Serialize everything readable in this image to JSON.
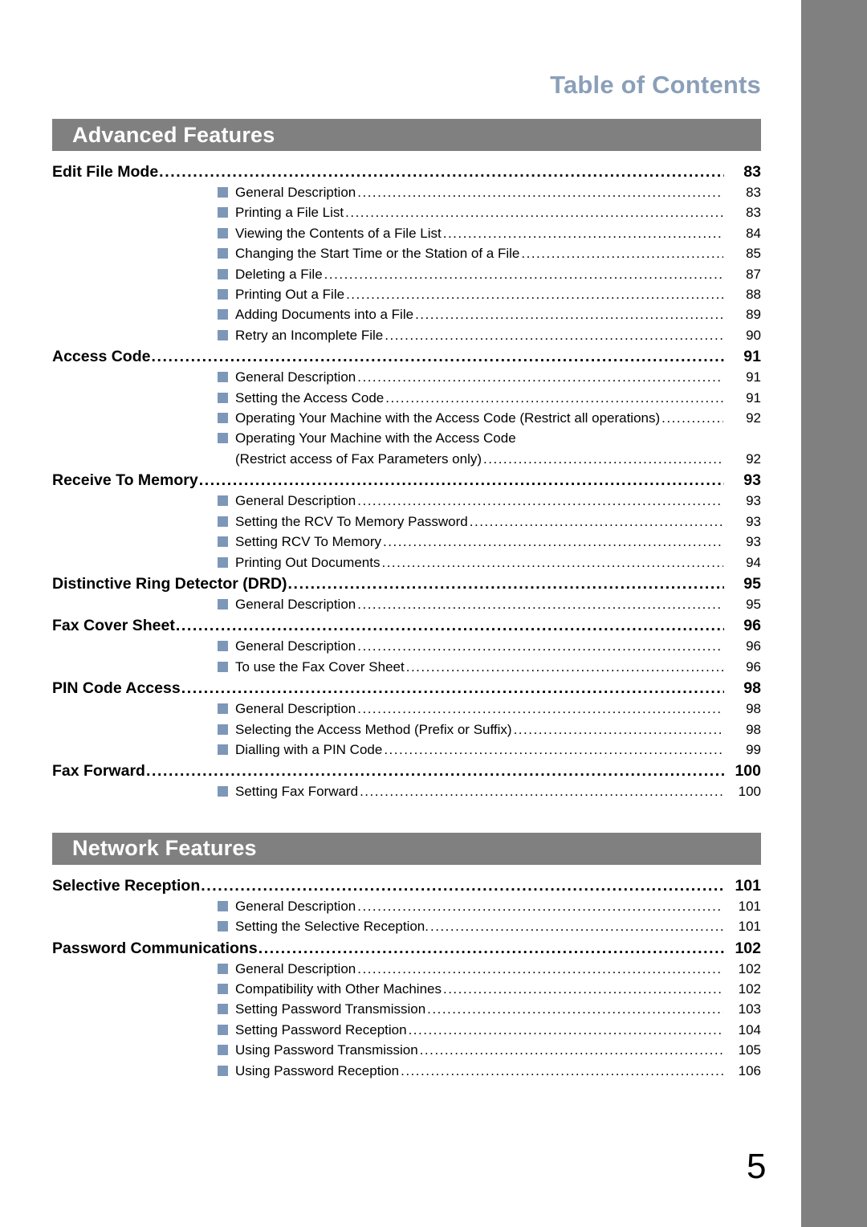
{
  "header": {
    "running_head": "Table of Contents"
  },
  "folio": "5",
  "leader_dots": "..................................................................................................................................................................",
  "sections": [
    {
      "band_label": "Advanced Features",
      "entries": [
        {
          "label": "Edit File Mode",
          "page": "83",
          "children": [
            {
              "label": "General Description",
              "page": "83"
            },
            {
              "label": "Printing a File List",
              "page": "83"
            },
            {
              "label": "Viewing the Contents of a File List",
              "page": "84"
            },
            {
              "label": "Changing the Start Time or the Station of a File",
              "page": "85"
            },
            {
              "label": "Deleting a File",
              "page": "87"
            },
            {
              "label": "Printing Out a File",
              "page": "88"
            },
            {
              "label": "Adding Documents into a File",
              "page": "89"
            },
            {
              "label": "Retry an Incomplete File",
              "page": "90"
            }
          ]
        },
        {
          "label": "Access Code",
          "page": "91",
          "children": [
            {
              "label": "General Description",
              "page": "91"
            },
            {
              "label": "Setting the Access Code",
              "page": "91"
            },
            {
              "label": "Operating Your Machine with the Access Code (Restrict all operations)",
              "page": "92"
            },
            {
              "label": "Operating Your Machine with the Access Code",
              "label_line2": "(Restrict access of Fax Parameters only)",
              "page": "92"
            }
          ]
        },
        {
          "label": "Receive To Memory",
          "page": "93",
          "children": [
            {
              "label": "General Description",
              "page": "93"
            },
            {
              "label": "Setting the RCV To Memory Password",
              "page": "93"
            },
            {
              "label": "Setting RCV To Memory",
              "page": "93"
            },
            {
              "label": "Printing Out Documents",
              "page": "94"
            }
          ]
        },
        {
          "label": "Distinctive Ring Detector (DRD)",
          "page": "95",
          "children": [
            {
              "label": "General Description",
              "page": "95"
            }
          ]
        },
        {
          "label": "Fax Cover Sheet",
          "page": "96",
          "children": [
            {
              "label": "General Description",
              "page": "96"
            },
            {
              "label": "To use the Fax Cover Sheet",
              "page": "96"
            }
          ]
        },
        {
          "label": "PIN Code Access",
          "page": "98",
          "children": [
            {
              "label": "General Description",
              "page": "98"
            },
            {
              "label": "Selecting the Access Method (Prefix or Suffix)",
              "page": "98"
            },
            {
              "label": "Dialling with a PIN Code",
              "page": "99"
            }
          ]
        },
        {
          "label": "Fax Forward",
          "page": "100",
          "children": [
            {
              "label": "Setting Fax Forward",
              "page": "100"
            }
          ]
        }
      ]
    },
    {
      "band_label": "Network Features",
      "entries": [
        {
          "label": "Selective Reception",
          "page": "101",
          "children": [
            {
              "label": "General Description",
              "page": "101"
            },
            {
              "label": "Setting the Selective Reception.",
              "page": "101"
            }
          ]
        },
        {
          "label": "Password Communications",
          "page": "102",
          "children": [
            {
              "label": "General Description",
              "page": "102"
            },
            {
              "label": "Compatibility with Other Machines",
              "page": "102"
            },
            {
              "label": "Setting Password Transmission",
              "page": "103"
            },
            {
              "label": "Setting Password Reception",
              "page": "104"
            },
            {
              "label": "Using Password Transmission",
              "page": "105"
            },
            {
              "label": "Using Password Reception",
              "page": "106"
            }
          ]
        }
      ]
    }
  ],
  "colors": {
    "band": "#808080",
    "running_head": "#8a9fb8",
    "bullet": "#7d97b8",
    "edge_band": "#808080"
  }
}
